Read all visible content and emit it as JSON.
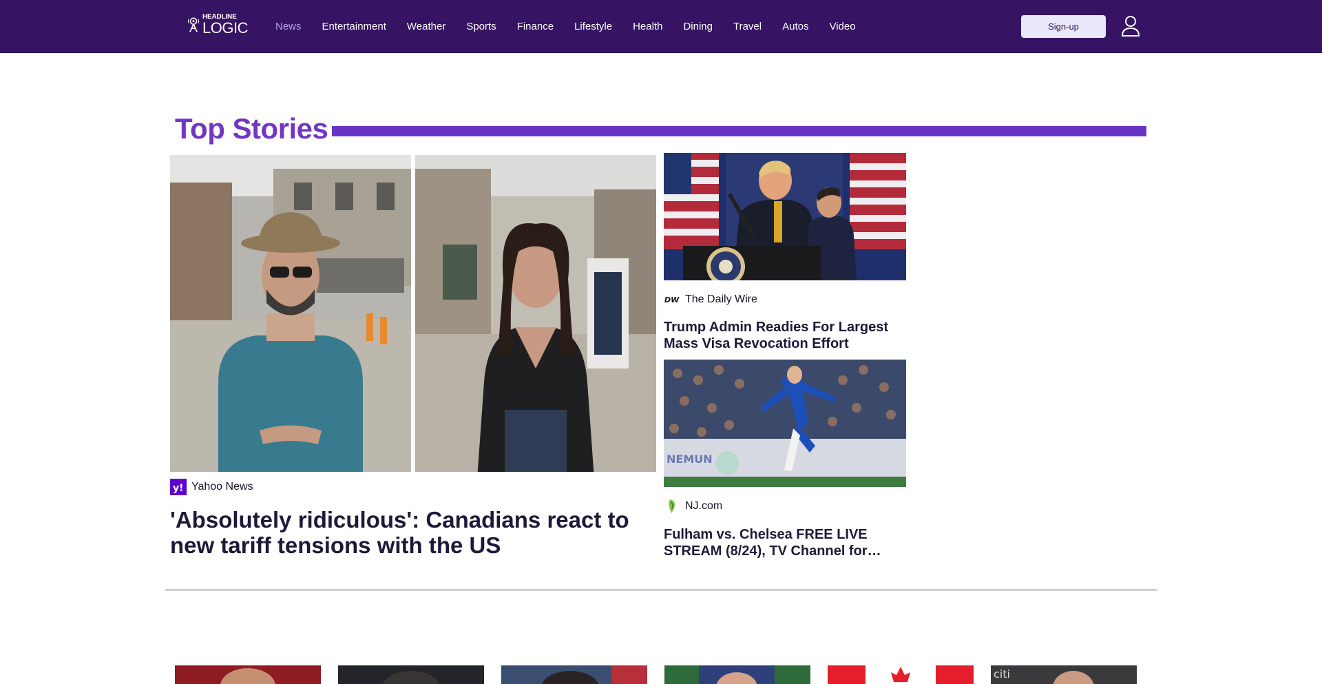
{
  "header": {
    "logo_small": "HEADLINE",
    "logo_big": "LOGIC",
    "nav": [
      {
        "label": "News",
        "active": true
      },
      {
        "label": "Entertainment"
      },
      {
        "label": "Weather"
      },
      {
        "label": "Sports"
      },
      {
        "label": "Finance"
      },
      {
        "label": "Lifestyle"
      },
      {
        "label": "Health"
      },
      {
        "label": "Dining"
      },
      {
        "label": "Travel"
      },
      {
        "label": "Autos"
      },
      {
        "label": "Video"
      }
    ],
    "signup_label": "Sign-up",
    "user_icon": "user-icon"
  },
  "top_stories": {
    "title": "Top Stories",
    "accent_color": "#6a35c4",
    "hero": {
      "source": "Yahoo News",
      "source_icon": "yahoo-icon",
      "headline": "'Absolutely ridiculous': Canadians react to new tariff tensions with the US"
    },
    "side": [
      {
        "source": "The Daily Wire",
        "source_icon": "dw-icon",
        "headline": "Trump Admin Readies For Largest Mass Visa Revocation Effort"
      },
      {
        "source": "NJ.com",
        "source_icon": "njcom-icon",
        "headline": "Fulham vs. Chelsea FREE LIVE STREAM (8/24), TV Channel for…"
      }
    ]
  },
  "colors": {
    "header_bg": "#361463",
    "title_color": "#7336c2",
    "signup_bg": "#ebe8fb"
  }
}
